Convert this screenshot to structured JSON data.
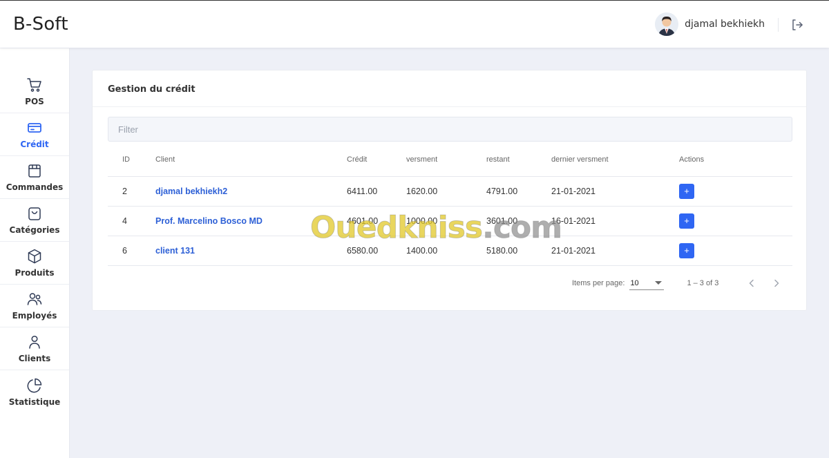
{
  "header": {
    "brand": "B-Soft",
    "user_name": "djamal bekhiekh"
  },
  "sidebar": {
    "active": "Crédit",
    "items": [
      {
        "label": "POS",
        "icon": "cart-icon"
      },
      {
        "label": "Crédit",
        "icon": "credit-card-icon"
      },
      {
        "label": "Commandes",
        "icon": "bag-icon"
      },
      {
        "label": "Catégories",
        "icon": "shopping-bag-icon"
      },
      {
        "label": "Produits",
        "icon": "box-icon"
      },
      {
        "label": "Employés",
        "icon": "users-icon"
      },
      {
        "label": "Clients",
        "icon": "user-icon"
      },
      {
        "label": "Statistique",
        "icon": "pie-chart-icon"
      }
    ]
  },
  "card": {
    "title": "Gestion du crédit",
    "filter_placeholder": "Filter"
  },
  "table": {
    "columns": [
      "ID",
      "Client",
      "Crédit",
      "versment",
      "restant",
      "dernier versment",
      "Actions"
    ],
    "rows": [
      {
        "id": "2",
        "client": "djamal bekhiekh2",
        "credit": "6411.00",
        "versment": "1620.00",
        "restant": "4791.00",
        "dernier": "21-01-2021",
        "action": "+"
      },
      {
        "id": "4",
        "client": "Prof. Marcelino Bosco MD",
        "credit": "4601.00",
        "versment": "1000.00",
        "restant": "3601.00",
        "dernier": "16-01-2021",
        "action": "+"
      },
      {
        "id": "6",
        "client": "client 131",
        "credit": "6580.00",
        "versment": "1400.00",
        "restant": "5180.00",
        "dernier": "21-01-2021",
        "action": "+"
      }
    ]
  },
  "paginator": {
    "items_per_page_label": "Items per page:",
    "items_per_page_value": "10",
    "range": "1 – 3 of 3"
  },
  "watermark": {
    "brand": "Ouedkniss",
    "suffix": ".com"
  },
  "colors": {
    "accent": "#2f66f3",
    "link": "#2c5fd6",
    "background": "#eef0f7"
  }
}
